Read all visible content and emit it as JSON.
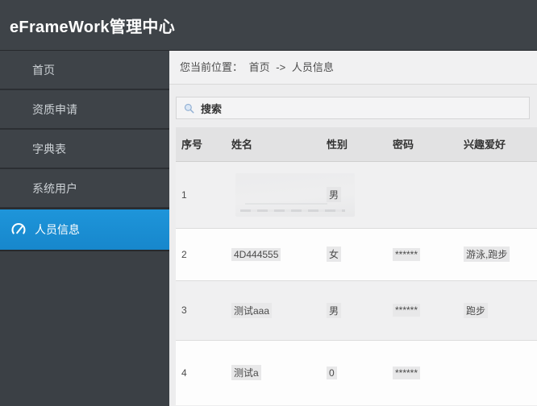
{
  "app": {
    "title": "eFrameWork管理中心"
  },
  "sidebar": {
    "items": [
      {
        "label": "首页",
        "active": false
      },
      {
        "label": "资质申请",
        "active": false
      },
      {
        "label": "字典表",
        "active": false
      },
      {
        "label": "系统用户",
        "active": false
      },
      {
        "label": "人员信息",
        "active": true,
        "icon": "gauge-icon"
      }
    ]
  },
  "breadcrumb": {
    "prefix": "您当前位置：",
    "home": "首页",
    "arrow": "->",
    "current": "人员信息"
  },
  "search": {
    "label": "搜索",
    "icon": "search-icon"
  },
  "table": {
    "columns": [
      "序号",
      "姓名",
      "性别",
      "密码",
      "兴趣爱好"
    ],
    "rows": [
      {
        "no": "1",
        "name": "",
        "gender": "男",
        "password": "",
        "hobby": ""
      },
      {
        "no": "2",
        "name": "4D444555",
        "gender": "女",
        "password": "******",
        "hobby": "游泳,跑步"
      },
      {
        "no": "3",
        "name": "测试aaa",
        "gender": "男",
        "password": "******",
        "hobby": "跑步"
      },
      {
        "no": "4",
        "name": "测试a",
        "gender": "0",
        "password": "******",
        "hobby": ""
      }
    ]
  },
  "colors": {
    "header_bg": "#3e4348",
    "sidebar_bg": "#3b4045",
    "active_item_blue": "#1a8fd1",
    "content_bg": "#ededee",
    "table_header_bg": "#e2e2e3",
    "row_stripe": "#f0f0f1",
    "value_highlight": "#e8e8e9"
  }
}
